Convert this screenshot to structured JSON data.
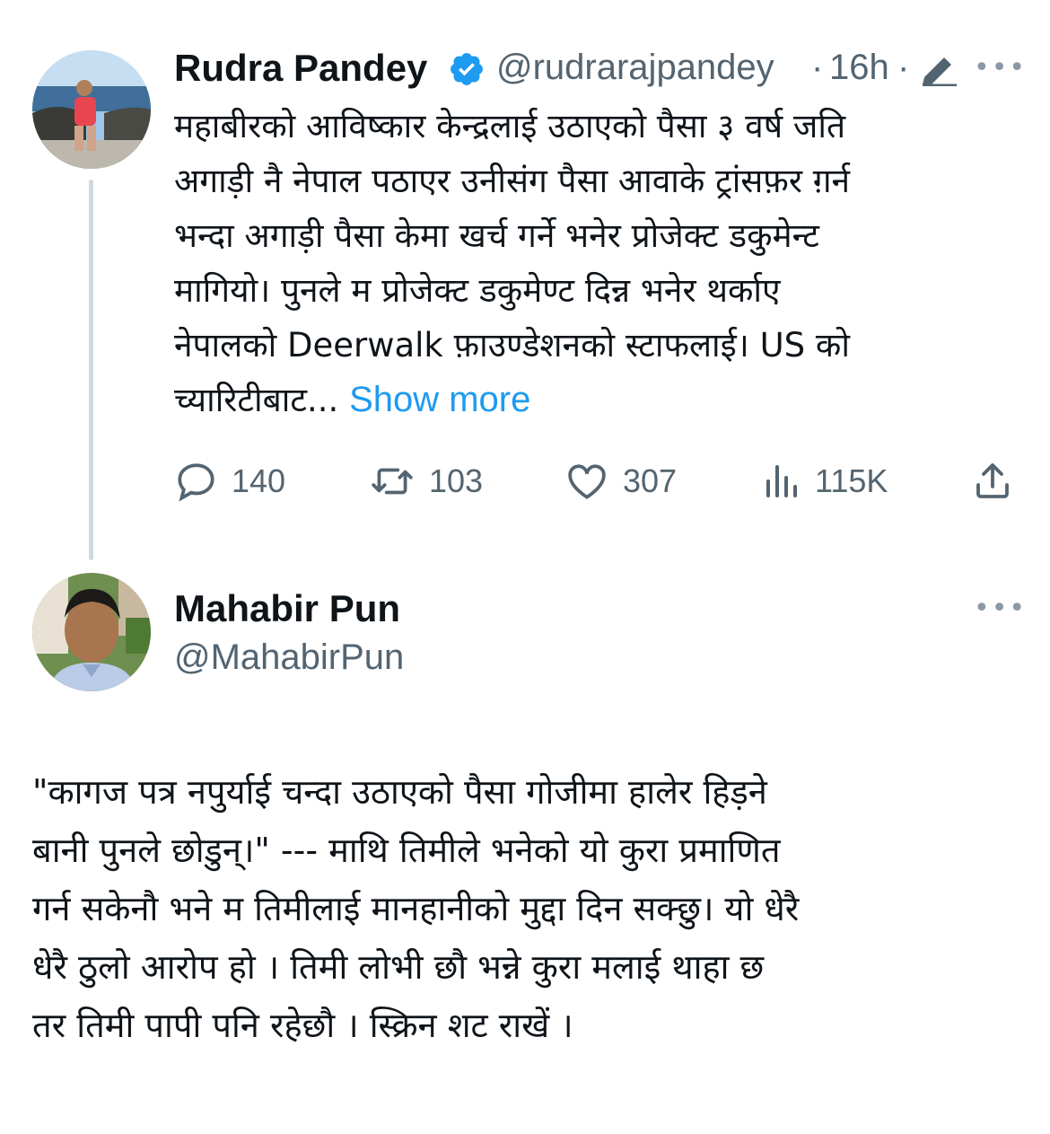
{
  "tweet1": {
    "name": "Rudra Pandey",
    "handle": "@rudrarajpandey",
    "dot1": "·",
    "time": "16h",
    "dot2": "·",
    "text": "महाबीरको आविष्कार केन्द्रलाई उठाएको पैसा ३ वर्ष जति\nअगाड़ी नै नेपाल पठाएर उनीसंग पैसा आवाके ट्रांसफ़र ग़र्न\nभन्दा अगाड़ी पैसा केमा खर्च गर्ने भनेर प्रोजेक्ट डकुमेन्ट\nमागियो। पुनले म प्रोजेक्ट डकुमेण्ट दिन्न भनेर थर्काए\nनेपालको Deerwalk फ़ाउण्डेशनको स्टाफलाई। US को\nच्यारिटीबाट...",
    "show_more": "Show more",
    "actions": {
      "replies": "140",
      "reposts": "103",
      "likes": "307",
      "views": "115K"
    }
  },
  "tweet2": {
    "name": "Mahabir Pun",
    "handle": "@MahabirPun",
    "text": "\"कागज पत्र नपुर्याई चन्दा उठाएको पैसा गोजीमा हालेर हिड़ने\nबानी पुनले छोडुन्।\" ---  माथि तिमीले भनेको यो कुरा प्रमाणित\nगर्न सकेनौ भने म तिमीलाई मानहानीको मुद्दा दिन सक्छु। यो धेरै\nधेरै ठुलो आरोप हो । तिमी लोभी छौ भन्ने कुरा मलाई थाहा छ\nतर तिमी पापी पनि रहेछौ । स्क्रिन शट राखें ।"
  },
  "colors": {
    "text": "#0f1419",
    "secondary": "#536471",
    "link": "#1d9bf0",
    "verified": "#1d9bf0",
    "thread_line": "#cfd9de"
  },
  "icons": [
    "verified-badge-icon",
    "edit-icon",
    "more-icon",
    "reply-icon",
    "repost-icon",
    "like-icon",
    "views-icon",
    "share-icon"
  ]
}
